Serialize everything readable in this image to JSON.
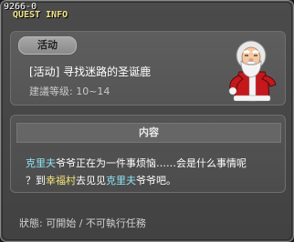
{
  "window": {
    "quest_id": "9266-0",
    "title": "QUEST INFO"
  },
  "quest": {
    "tag": "活动",
    "name": "[活动] 寻找迷路的圣诞鹿",
    "level": "建議等级: 10~14",
    "npc_icon": "santa-npc-icon"
  },
  "content": {
    "header": "内容",
    "line1": {
      "npc_a": "克里夫",
      "text_a": "爷爷正在为一件事烦恼……会是什么事情呢"
    },
    "line2": {
      "text_a": "？到",
      "place": "幸福村",
      "text_b": "去见见",
      "npc_b": "克里夫",
      "text_c": "爷爷吧。"
    }
  },
  "status": "狀態: 可開始 / 不可執行任務",
  "colors": {
    "npc_highlight": "#8ee6f5",
    "place_highlight": "#f5e77a",
    "title": "#f2e58a"
  }
}
